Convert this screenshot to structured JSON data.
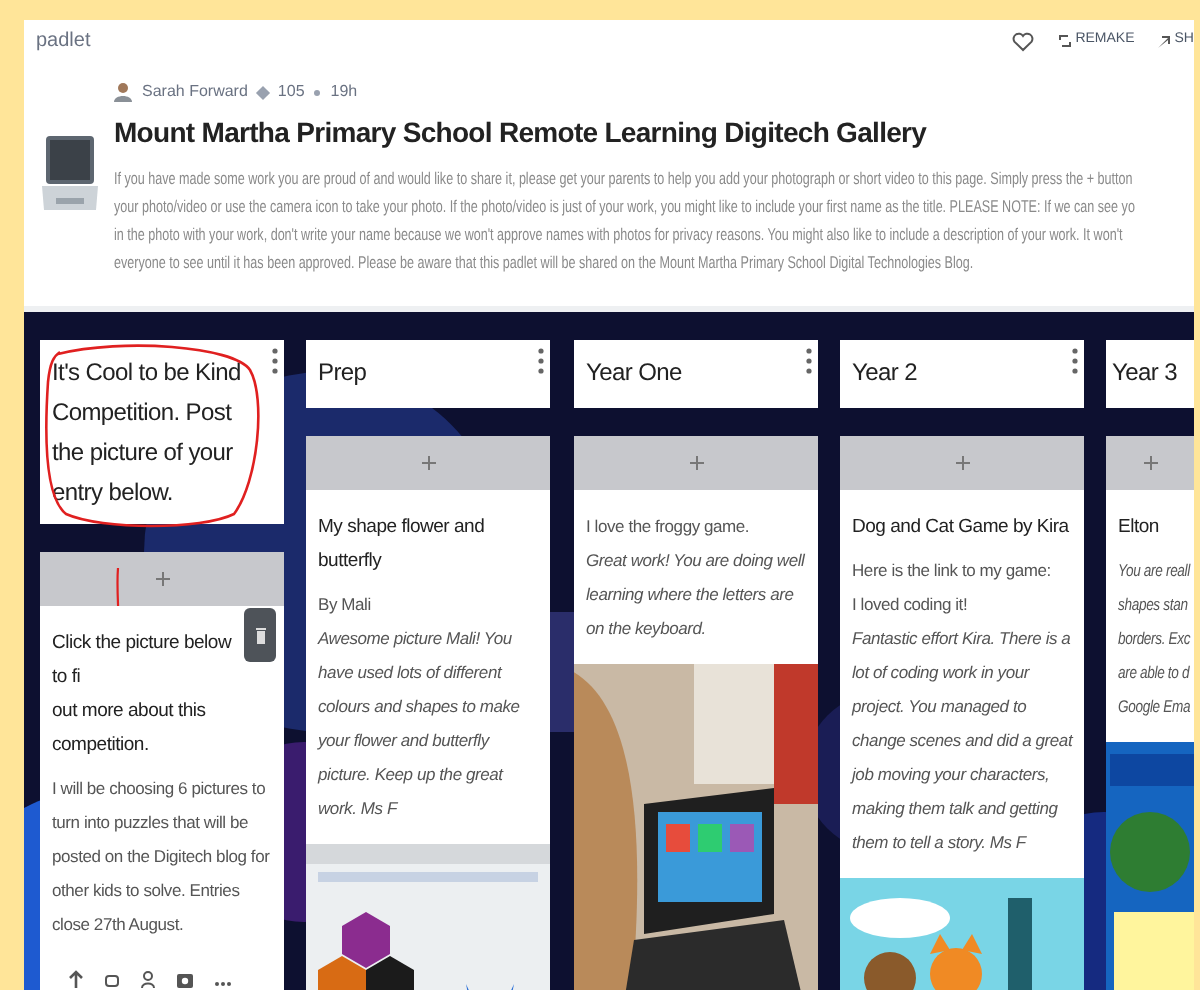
{
  "app": {
    "logo": "padlet",
    "actions": [
      {
        "kind": "like"
      },
      {
        "kind": "remake",
        "label": "REMAKE"
      },
      {
        "kind": "share",
        "label": "SH"
      }
    ]
  },
  "header": {
    "author": "Sarah Forward",
    "likes": "105",
    "age": "19h",
    "title": "Mount Martha Primary School Remote Learning Digitech Gallery",
    "description_lines": [
      "If you have made some work you are proud of and would like to share it, please get your parents to help you add your photograph or short video to this page. Simply press the + button",
      "your photo/video or use the camera icon to take your photo. If the photo/video is just of your work, you might like to include your first name as the title. PLEASE NOTE: If we can see yo",
      "in the photo with your work, don't write your name because we won't approve names with photos for privacy reasons. You might also like to include a description of your work. It won't",
      "everyone to see until it has been approved. Please be aware that this padlet will be shared on the Mount Martha Primary School Digital Technologies Blog."
    ]
  },
  "columns": [
    {
      "title": "It's Cool to be Kind Competition. Post the picture of your entry below.",
      "annotated": true,
      "menu": true,
      "posts": [
        {
          "title": "Click the picture below to fi",
          "title_more": "out more about this competition.",
          "body": [
            {
              "kind": "paragraph",
              "text": "I will be choosing 6 pictures to turn into puzzles that will be posted on the Digitech blog for other kids to solve. Entries close 27th August.",
              "italic": false
            }
          ],
          "actions": true,
          "picture": false
        }
      ]
    },
    {
      "title": "Prep",
      "annotated": false,
      "menu": true,
      "posts": [
        {
          "title": "My shape flower and butterfly",
          "body": [
            {
              "kind": "paragraph",
              "text": "By Mali",
              "italic": false
            },
            {
              "kind": "paragraph",
              "text": "Awesome picture Mali! You have used lots of different colours and shapes to make your flower and butterfly picture. Keep up the great work. Ms F",
              "italic": true
            }
          ],
          "actions": false,
          "picture": true
        }
      ]
    },
    {
      "title": "Year One",
      "annotated": false,
      "menu": true,
      "posts": [
        {
          "body": [
            {
              "kind": "paragraph",
              "text": "I love the froggy game.",
              "italic": false
            },
            {
              "kind": "paragraph",
              "text": "Great work! You are doing well learning where the letters are on the keyboard.",
              "italic": true
            }
          ],
          "actions": false,
          "picture": true
        }
      ]
    },
    {
      "title": "Year 2",
      "annotated": false,
      "menu": true,
      "posts": [
        {
          "title": "Dog and Cat Game by Kira",
          "body": [
            {
              "kind": "paragraph",
              "text": "Here is the link to my game:",
              "italic": false
            },
            {
              "kind": "paragraph",
              "text": "I loved coding it!",
              "italic": false
            },
            {
              "kind": "paragraph",
              "text": "Fantastic effort Kira. There is a lot of coding work in your project. You managed to change scenes and did a great job moving your characters, making them talk and getting them to tell a story. Ms F",
              "italic": true
            }
          ],
          "actions": false,
          "picture": true
        }
      ]
    },
    {
      "title": "Year 3",
      "annotated": false,
      "menu": false,
      "posts": [
        {
          "title": "Elton",
          "body": [
            {
              "kind": "line",
              "text": "You are reall",
              "italic": true
            },
            {
              "kind": "line",
              "text": "shapes stan",
              "italic": true
            },
            {
              "kind": "line",
              "text": "borders. Exc",
              "italic": true
            },
            {
              "kind": "line",
              "text": "are able to d",
              "italic": true
            },
            {
              "kind": "line",
              "text": "Google Ema",
              "italic": true
            }
          ],
          "actions": false,
          "picture": true
        }
      ]
    }
  ]
}
